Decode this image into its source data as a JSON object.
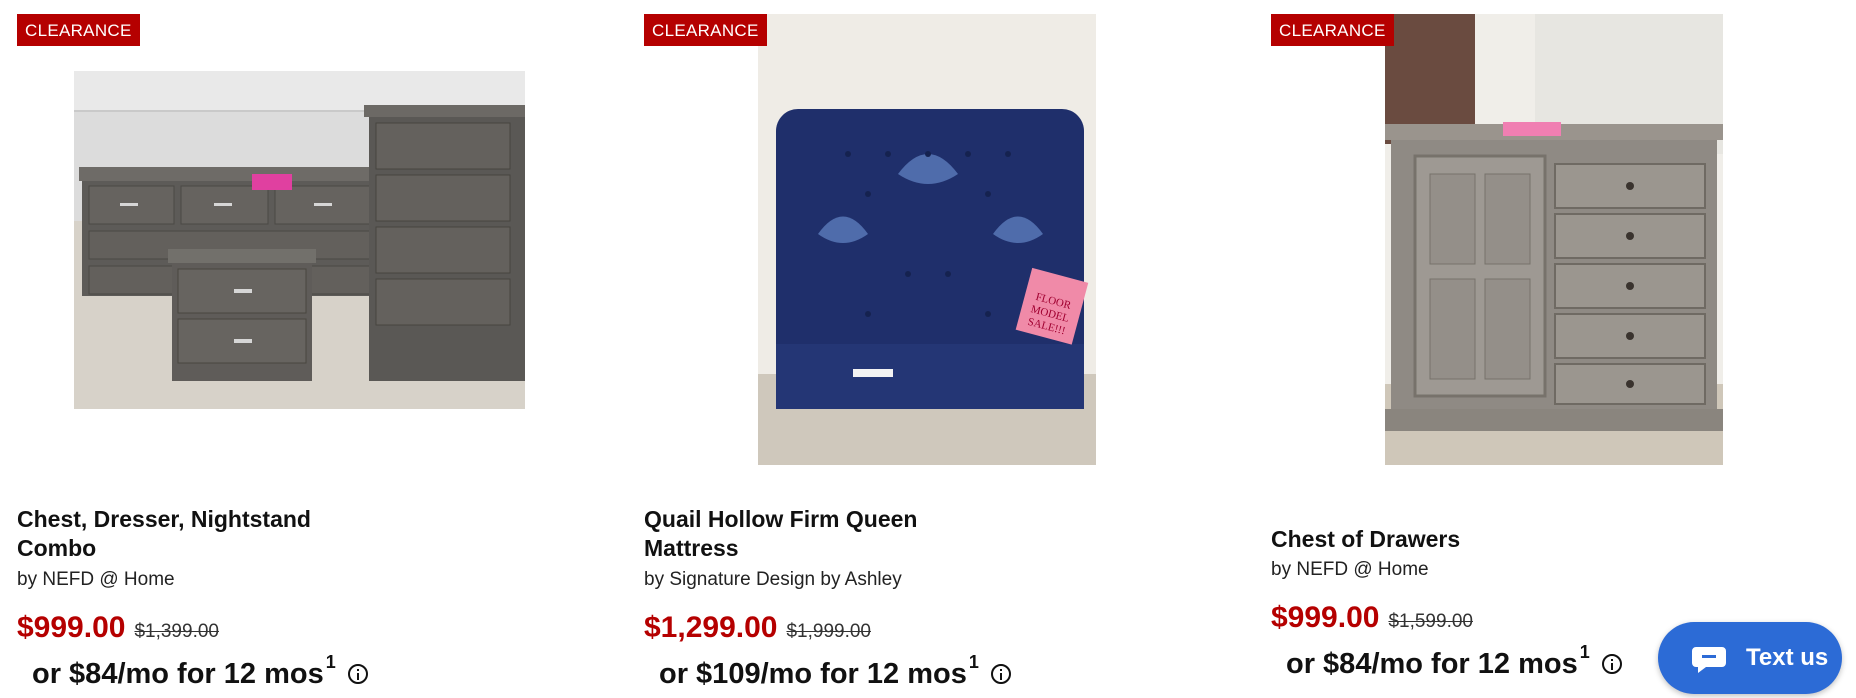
{
  "products": [
    {
      "badge": "CLEARANCE",
      "title": "Chest, Dresser, Nightstand Combo",
      "brand": "by NEFD @ Home",
      "price": "$999.00",
      "was_price": "$1,399.00",
      "finance": "or $84/mo for 12 mos",
      "finance_footnote": "1",
      "image_subject": "gray bedroom set: chest, dresser and nightstand"
    },
    {
      "badge": "CLEARANCE",
      "title": "Quail Hollow Firm Queen Mattress",
      "brand": "by Signature Design by Ashley",
      "price": "$1,299.00",
      "was_price": "$1,999.00",
      "finance": "or $109/mo for 12 mos",
      "finance_footnote": "1",
      "image_subject": "navy blue mattress with floor model sale tag",
      "tag_text": "FLOOR MODEL SALE!!!"
    },
    {
      "badge": "CLEARANCE",
      "title": "Chest of Drawers",
      "brand": "by NEFD @ Home",
      "price": "$999.00",
      "was_price": "$1,599.00",
      "finance": "or $84/mo for 12 mos",
      "finance_footnote": "1",
      "image_subject": "weathered gray chest of drawers with cabinet door"
    }
  ],
  "chat_widget": {
    "label": "Text us",
    "icon": "chat-bubble-icon"
  },
  "colors": {
    "accent_red": "#b50000",
    "chat_blue": "#2c6bd6"
  }
}
